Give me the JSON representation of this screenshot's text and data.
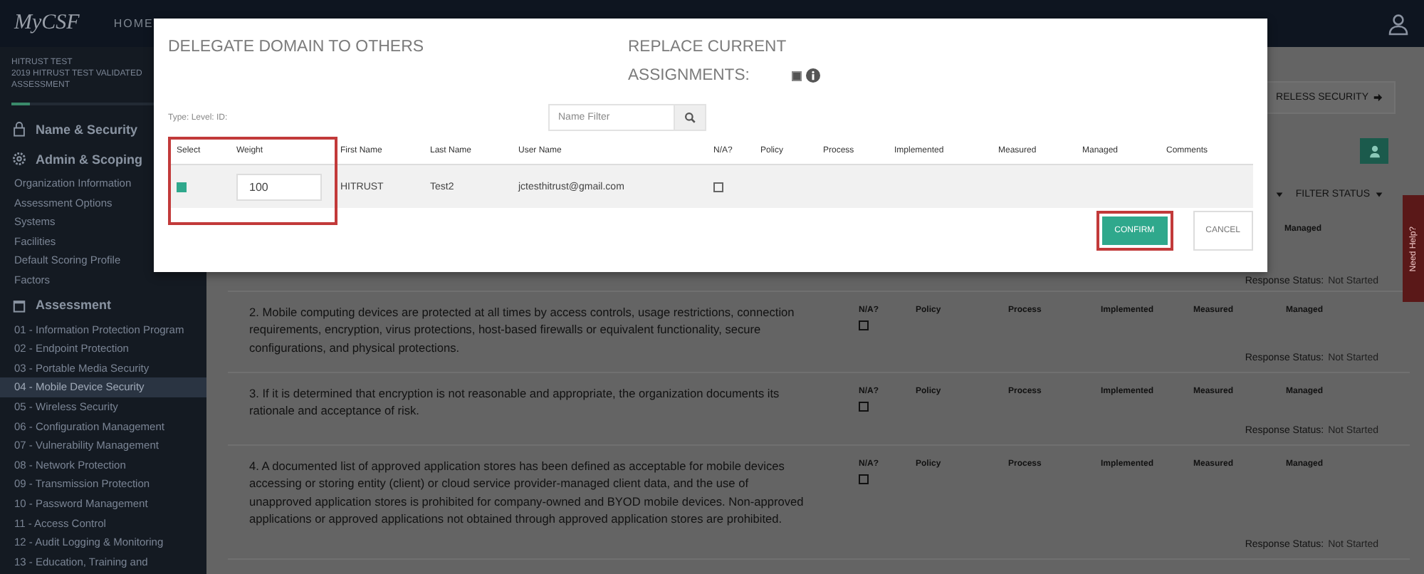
{
  "header": {
    "logo": "MyCSF",
    "nav": [
      "HOME"
    ]
  },
  "sidebar": {
    "assessment_lines": [
      "HITRUST TEST",
      "2019 HITRUST TEST VALIDATED",
      "ASSESSMENT"
    ],
    "progress": {
      "level": 0.1
    },
    "sections": [
      {
        "label": "Name & Security"
      },
      {
        "label": "Admin & Scoping",
        "items": [
          {
            "label": "Organization Information",
            "selected": false
          },
          {
            "label": "Assessment Options",
            "selected": false
          },
          {
            "label": "Systems",
            "selected": false
          },
          {
            "label": "Facilities",
            "selected": false
          },
          {
            "label": "Default Scoring Profile",
            "selected": false
          },
          {
            "label": "Factors",
            "selected": false
          }
        ]
      },
      {
        "label": "Assessment",
        "items": [
          {
            "label": "01 - Information Protection Program",
            "selected": false
          },
          {
            "label": "02 - Endpoint Protection",
            "selected": false
          },
          {
            "label": "03 - Portable Media Security",
            "selected": false
          },
          {
            "label": "04 - Mobile Device Security",
            "selected": true
          },
          {
            "label": "05 - Wireless Security",
            "selected": false
          },
          {
            "label": "06 - Configuration Management",
            "selected": false
          },
          {
            "label": "07 - Vulnerability Management",
            "selected": false
          },
          {
            "label": "08 - Network Protection",
            "selected": false
          },
          {
            "label": "09 - Transmission Protection",
            "selected": false
          },
          {
            "label": "10 - Password Management",
            "selected": false
          },
          {
            "label": "11 - Access Control",
            "selected": false
          },
          {
            "label": "12 - Audit Logging & Monitoring",
            "selected": false
          },
          {
            "label": "13 - Education, Training and",
            "selected": false
          }
        ]
      }
    ]
  },
  "main": {
    "next_button": "RELESS SECURITY",
    "filters": [
      "FILTER STATUS"
    ],
    "partial_row": {
      "columns": [
        "Managed"
      ],
      "status_label": "Response Status:",
      "status": "Not Started"
    },
    "questions": [
      {
        "text": "2. Mobile computing devices are protected at all times by access controls, usage restrictions, connection requirements, encryption, virus protections, host-based firewalls or equivalent functionality, secure configurations, and physical protections.",
        "na_label": "N/A?",
        "na_checked": false,
        "columns": [
          "Policy",
          "Process",
          "Implemented",
          "Measured",
          "Managed"
        ],
        "status_label": "Response Status:",
        "status": "Not Started"
      },
      {
        "text": "3. If it is determined that encryption is not reasonable and appropriate, the organization documents its rationale and acceptance of risk.",
        "na_label": "N/A?",
        "na_checked": false,
        "columns": [
          "Policy",
          "Process",
          "Implemented",
          "Measured",
          "Managed"
        ],
        "status_label": "Response Status:",
        "status": "Not Started"
      },
      {
        "text": "4. A documented list of approved application stores has been defined as acceptable for mobile devices accessing or storing entity (client) or cloud service provider-managed client data, and the use of unapproved application stores is prohibited for company-owned and BYOD mobile devices. Non-approved applications or approved applications not obtained through approved application stores are prohibited.",
        "na_label": "N/A?",
        "na_checked": false,
        "columns": [
          "Policy",
          "Process",
          "Implemented",
          "Measured",
          "Managed"
        ],
        "status_label": "Response Status:",
        "status": "Not Started"
      }
    ]
  },
  "help_tab": "Need Help?",
  "modal": {
    "title": "DELEGATE DOMAIN TO OTHERS",
    "replace_label": "REPLACE CURRENT ASSIGNMENTS:",
    "replace_checked": true,
    "meta": "Type:  Level:  ID:",
    "filter": {
      "placeholder": "Name Filter"
    },
    "table": {
      "highlighted": true,
      "columns": [
        "Select",
        "Weight",
        "First Name",
        "Last Name",
        "User Name",
        "N/A?",
        "Policy",
        "Process",
        "Implemented",
        "Measured",
        "Managed",
        "Comments"
      ],
      "rows": [
        {
          "selected": true,
          "weight": "100",
          "first_name": "HITRUST",
          "last_name": "Test2",
          "user_name": "jctesthitrust@gmail.com",
          "na_checked": false
        }
      ]
    },
    "buttons": [
      {
        "label": "CONFIRM",
        "kind": "primary",
        "highlighted": true
      },
      {
        "label": "CANCEL",
        "kind": "secondary",
        "highlighted": false
      }
    ]
  }
}
